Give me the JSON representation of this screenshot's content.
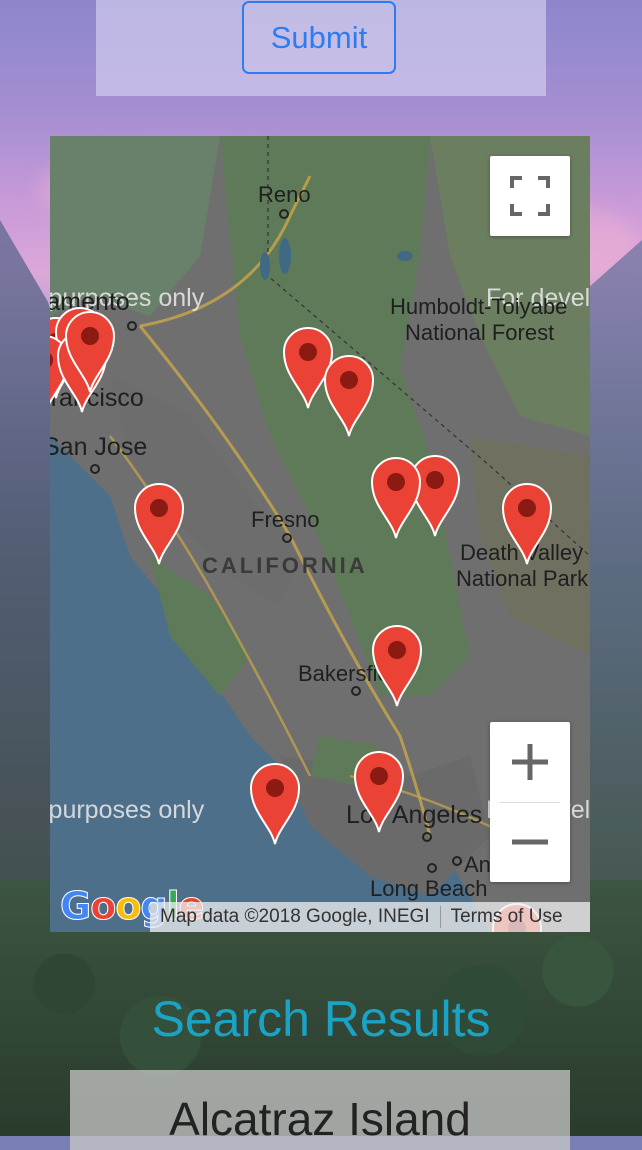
{
  "form": {
    "submit_label": "Submit"
  },
  "map": {
    "watermark": "For development purposes only",
    "labels": {
      "reno": "Reno",
      "sacramento": "Sacramento",
      "san_francisco": "San Francisco",
      "san_jose": "San Jose",
      "fresno": "Fresno",
      "california": "CALIFORNIA",
      "humboldt_line1": "Humboldt-Toiyabe",
      "humboldt_line2": "National Forest",
      "death_valley_line1": "Death Valley",
      "death_valley_line2": "National Park",
      "bakersfield": "Bakersfield",
      "los_angeles": "Los Angeles",
      "anaheim": "Anaheim",
      "long_beach": "Long Beach"
    },
    "attribution": "Map data ©2018 Google, INEGI",
    "terms_label": "Terms of Use",
    "logo_letters": [
      "G",
      "o",
      "o",
      "g",
      "l",
      "e"
    ],
    "marker_color": "#ea4335",
    "marker_count": 15
  },
  "results": {
    "title": "Search Results",
    "items": [
      {
        "name": "Alcatraz Island"
      }
    ]
  }
}
